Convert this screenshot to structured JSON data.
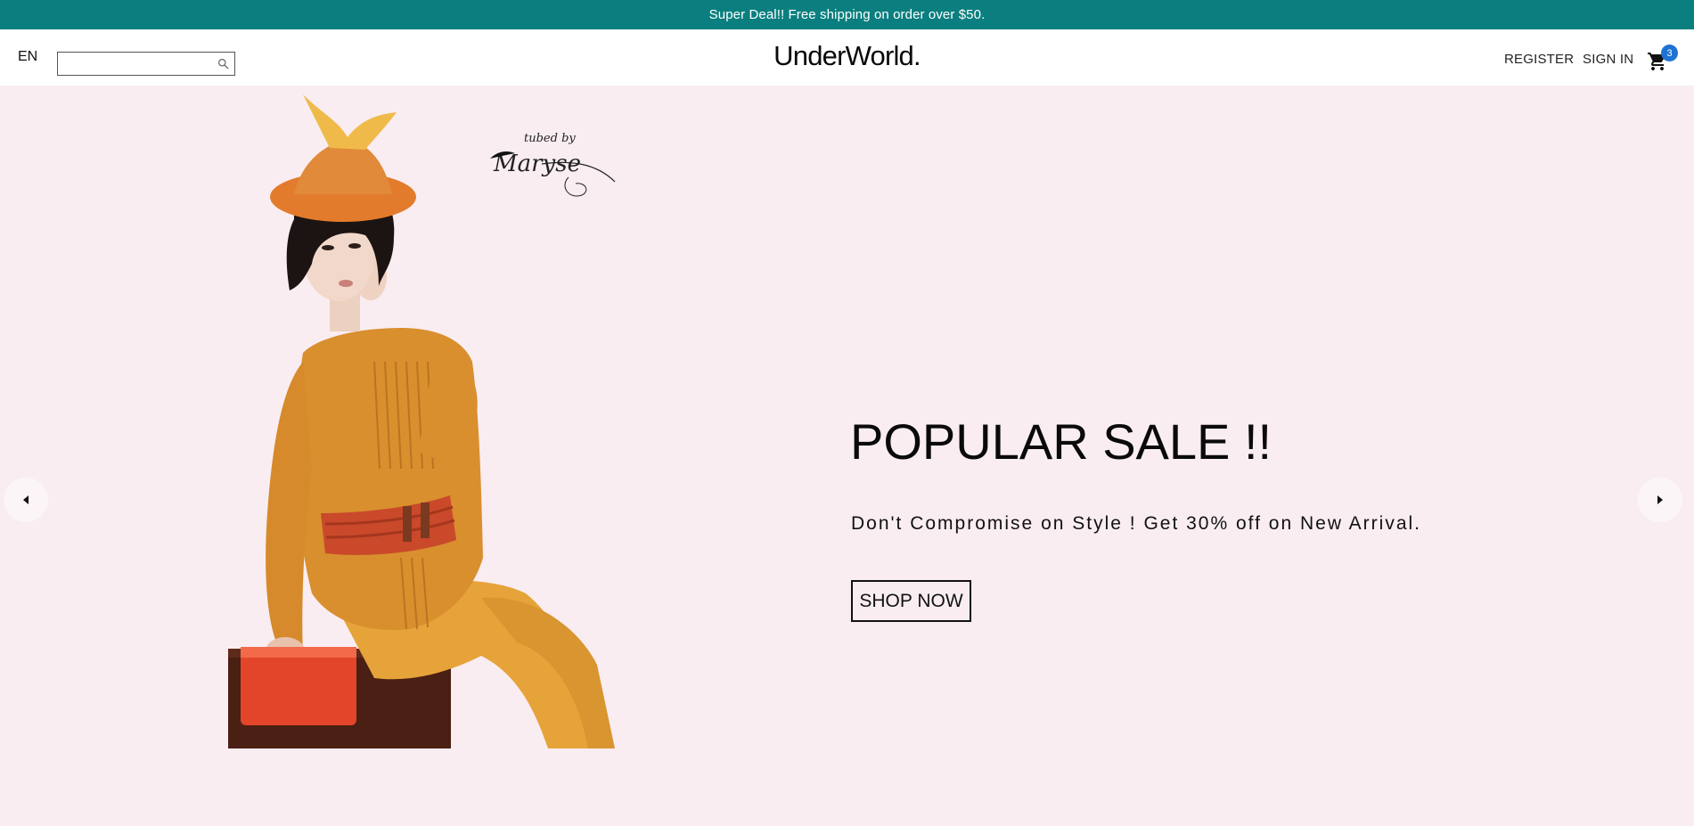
{
  "announcement": {
    "text": "Super Deal!! Free shipping on order over $50."
  },
  "header": {
    "language": "EN",
    "search_value": "",
    "search_placeholder": "",
    "logo": "UnderWorld.",
    "register_label": "REGISTER",
    "signin_label": "SIGN IN",
    "cart_count": "3",
    "search_icon": "search-icon",
    "cart_icon": "shopping-cart-icon"
  },
  "hero": {
    "title": "POPULAR SALE !!",
    "subtitle": "Don't Compromise on Style ! Get 30% off on New Arrival.",
    "button_label": "SHOP NOW",
    "image_alt": "model-in-orange-outfit",
    "signature_text_top": "tubed by",
    "signature_text_main": "Maryse",
    "prev_icon": "chevron-left-icon",
    "next_icon": "chevron-right-icon"
  },
  "colors": {
    "announcement_bg": "#0b7f7f",
    "hero_bg": "#f9edf1",
    "badge": "#1e73d2",
    "outfit": "#d9932f",
    "hat": "#e37b2c",
    "bag": "#e2452a"
  }
}
